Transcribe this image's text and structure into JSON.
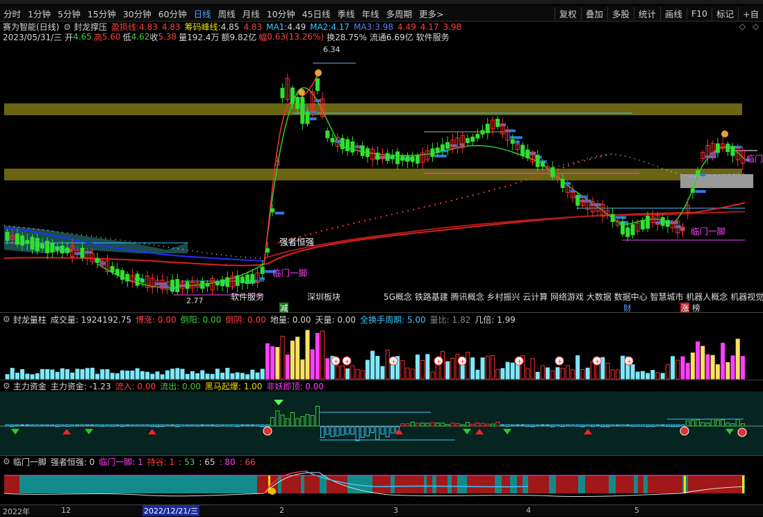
{
  "period_bar": {
    "items": [
      "分时",
      "1分钟",
      "5分钟",
      "15分钟",
      "30分钟",
      "60分钟",
      "日线",
      "周线",
      "月线",
      "10分钟",
      "45日线",
      "季线",
      "年线",
      "多周期",
      "更多>"
    ],
    "active": "日线",
    "right_tools": [
      "复权",
      "叠加",
      "多股",
      "统计",
      "画线",
      "F10",
      "标记",
      "+自"
    ]
  },
  "main_header": {
    "stock": "赛为智能(日线)",
    "indicator_name": "封龙撑压",
    "ind1_label": "盈损线: ",
    "ind1_val": "4.83",
    "ind1_val2": "4.83",
    "ind2_label": "筹码峰线: ",
    "ind2_val": "4.85",
    "ma1_label": "MA1: ",
    "ma1_val": "4.49",
    "ma2_label": "MA2: ",
    "ma2_val": "4.17",
    "ma3_label": "MA3: ",
    "ma3_val": "3.98",
    "extra1": "4.49",
    "extra2": "4.17",
    "extra3": "3.98",
    "date": "2023/05/31/三",
    "open_label": "开",
    "open": "4.65",
    "high_label": "高",
    "high": "5.60",
    "low_label": "低",
    "low": "4.62",
    "close_label": "收",
    "close": "5.38",
    "vol_label": "量",
    "vol": "192.4万",
    "amt_label": "额",
    "amt": "9.82亿",
    "chg_label": "幅",
    "chg": "0.63(13.26%)",
    "turnover": "换28.75%",
    "float": "流通6.69亿",
    "sector": "软件服务"
  },
  "main_chart": {
    "price_high_label": "6.34",
    "price_low_label": "2.77",
    "annotations": {
      "strong": "强者恒强",
      "door1": "临门一脚",
      "door2": "临门一脚",
      "door3": "临门一脚",
      "sector_tag": "软件服务",
      "board_tag": "深圳板块"
    },
    "concepts": "5G概念 铁路基建 腾讯概念 乡村振兴 云计算 网络游戏 大数据 数据中心 智慧城市 机器人概念 机器视觉 元",
    "badges": {
      "reduce": "减",
      "finance": "财",
      "rank1": "涨",
      "rank2": "榜"
    }
  },
  "vol_panel": {
    "name": "封龙量柱",
    "items": [
      {
        "label": "成交量: ",
        "value": "1924192.75",
        "color": "#d8d8d8"
      },
      {
        "label": "博涨: ",
        "value": "0.00",
        "color": "#ff4040"
      },
      {
        "label": "倒阳: ",
        "value": "0.00",
        "color": "#40d040"
      },
      {
        "label": "倒阴: ",
        "value": "0.00",
        "color": "#ff4040"
      },
      {
        "label": "地量: ",
        "value": "0.00",
        "color": "#d8d8d8"
      },
      {
        "label": "天量: ",
        "value": "0.00",
        "color": "#d8d8d8"
      },
      {
        "label": "全换手周期: ",
        "value": "5.00",
        "color": "#38c8ff"
      },
      {
        "label": "量比: ",
        "value": "1.82",
        "color": "#888888"
      },
      {
        "label": "几倍: ",
        "value": "1.99",
        "color": "#d8d8d8"
      }
    ]
  },
  "fund_panel": {
    "name": "主力资金",
    "items": [
      {
        "label": "主力资金: ",
        "value": "-1.23",
        "color": "#d8d8d8"
      },
      {
        "label": "流入: ",
        "value": "0.00",
        "color": "#ff4040"
      },
      {
        "label": "流出: ",
        "value": "0.00",
        "color": "#40d040"
      },
      {
        "label": "黑马起爆: ",
        "value": "1.00",
        "color": "#e8e000"
      },
      {
        "label": "非妖即顶: ",
        "value": "0.00",
        "color": "#ff40ff"
      }
    ]
  },
  "door_panel": {
    "name": "临门一脚",
    "items": [
      {
        "label": "强者恒强: ",
        "value": "0",
        "color": "#d8d8d8"
      },
      {
        "label": "临门一脚: ",
        "value": "1",
        "color": "#ff40ff"
      },
      {
        "label": "持谷: ",
        "value": "1",
        "color": "#ff4040"
      },
      {
        "label": ": ",
        "value": "53",
        "color": "#40d040"
      },
      {
        "label": ": ",
        "value": "65",
        "color": "#d8d8d8"
      },
      {
        "label": ": ",
        "value": "80",
        "color": "#ff40ff"
      },
      {
        "label": ": ",
        "value": "66",
        "color": "#ff4040"
      }
    ]
  },
  "time_axis": {
    "labels": [
      "2022年",
      "12",
      "2022/12/21/三",
      "2",
      "3",
      "4",
      "5"
    ]
  },
  "colors": {
    "up": "#ff3030",
    "down": "#30e030",
    "band": "#6b6413",
    "ma_red": "#e02020",
    "cyan": "#38c8ff"
  }
}
